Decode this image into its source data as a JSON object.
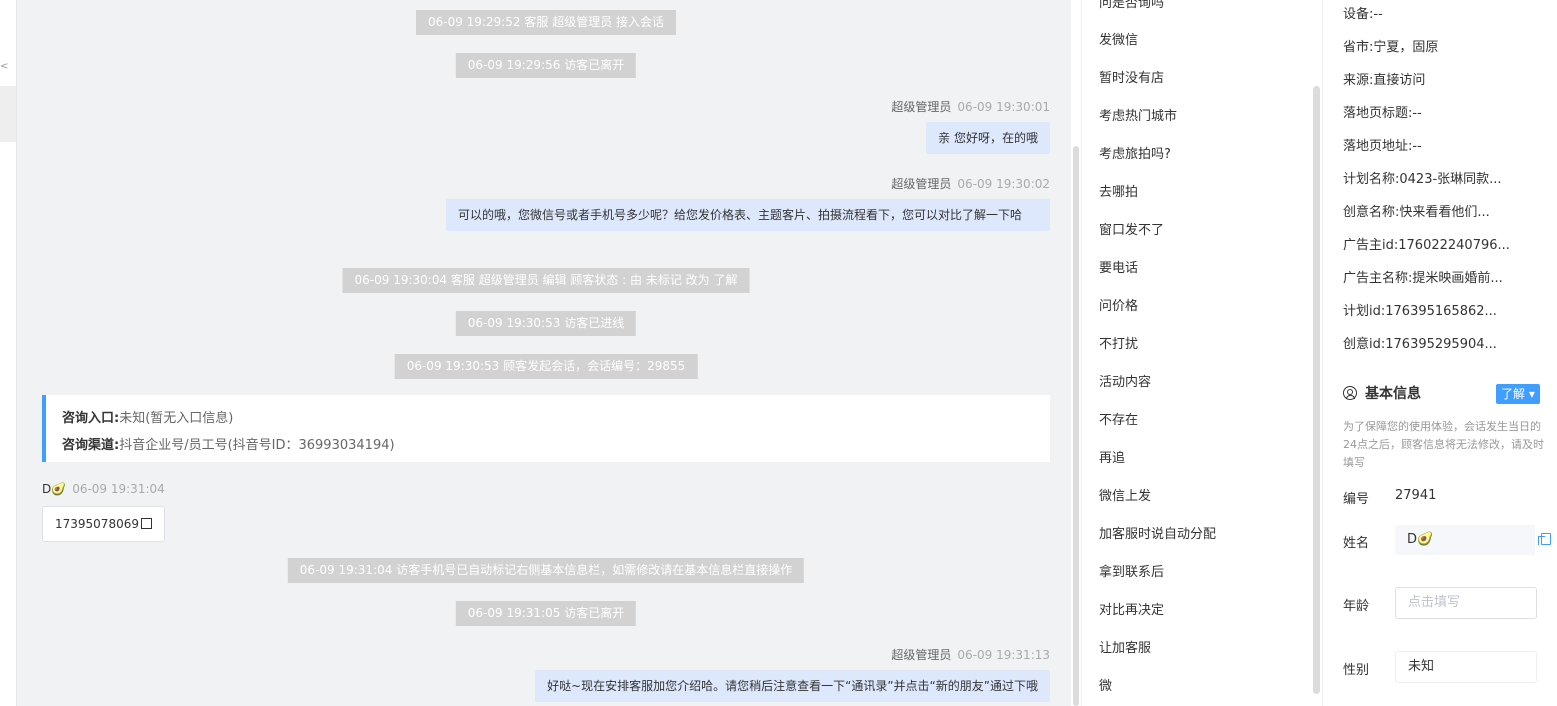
{
  "left_strip": {
    "marks": [
      "<",
      "<"
    ]
  },
  "chat": {
    "system_messages": [
      "06-09 19:29:52 客服 超级管理员 接入会话",
      "06-09 19:29:56 访客已离开",
      "06-09 19:30:04 客服 超级管理员 编辑 顾客状态 : 由 未标记 改为 了解",
      "06-09 19:30:53 访客已进线",
      "06-09 19:30:53 顾客发起会话，会话编号：29855",
      "06-09 19:31:04 访客手机号已自动标记右侧基本信息栏，如需修改请在基本信息栏直接操作",
      "06-09 19:31:05 访客已离开"
    ],
    "agent_messages": [
      {
        "name": "超级管理员",
        "time": "06-09 19:30:01",
        "text": "亲 您好呀，在的哦"
      },
      {
        "name": "超级管理员",
        "time": "06-09 19:30:02",
        "text": "可以的哦，您微信号或者手机号多少呢？给您发价格表、主题客片、拍摄流程看下，您可以对比了解一下哈"
      },
      {
        "name": "超级管理员",
        "time": "06-09 19:31:13",
        "text": "好哒~现在安排客服加您介绍哈。请您稍后注意查看一下“通讯录”并点击“新的朋友”通过下哦"
      }
    ],
    "info_card": {
      "entry_label": "咨询入口:",
      "entry_value": "未知(暂无入口信息)",
      "channel_label": "咨询渠道:",
      "channel_value": "抖音企业号/员工号(抖音号ID：36993034194)"
    },
    "visitor": {
      "name": "D🥑",
      "time": "06-09 19:31:04",
      "phone": "17395078069"
    }
  },
  "quick_replies": {
    "items": [
      "问是否询吗",
      "发微信",
      "暂时没有店",
      "考虑热门城市",
      "考虑旅拍吗?",
      "去哪拍",
      "窗口发不了",
      "要电话",
      "问价格",
      "不打扰",
      "活动内容",
      "不存在",
      "再追",
      "微信上发",
      "加客服时说自动分配",
      "拿到联系后",
      "对比再决定",
      "让加客服",
      "微"
    ]
  },
  "right_panel": {
    "fields": [
      {
        "label": "设备:",
        "value": "--"
      },
      {
        "label": "省市:",
        "value": "宁夏，固原"
      },
      {
        "label": "来源:",
        "value": "直接访问"
      },
      {
        "label": "落地页标题:",
        "value": "--"
      },
      {
        "label": "落地页地址:",
        "value": "--"
      },
      {
        "label": "计划名称:",
        "value": "0423-张琳同款..."
      },
      {
        "label": "创意名称:",
        "value": "快来看看他们..."
      },
      {
        "label": "广告主id:",
        "value": "176022240796..."
      },
      {
        "label": "广告主名称:",
        "value": "提米映画婚前..."
      },
      {
        "label": "计划id:",
        "value": "176395165862..."
      },
      {
        "label": "创意id:",
        "value": "176395295904..."
      }
    ],
    "basic_info": {
      "title": "基本信息",
      "learn_button": "了解 ▾",
      "notice": "为了保障您的使用体验，会话发生当日的24点之后，顾客信息将无法修改，请及时填写",
      "id_label": "编号",
      "id_value": "27941",
      "name_label": "姓名",
      "name_value": "D🥑",
      "age_label": "年龄",
      "age_placeholder": "点击填写",
      "gender_label": "性别",
      "gender_value": "未知"
    }
  }
}
